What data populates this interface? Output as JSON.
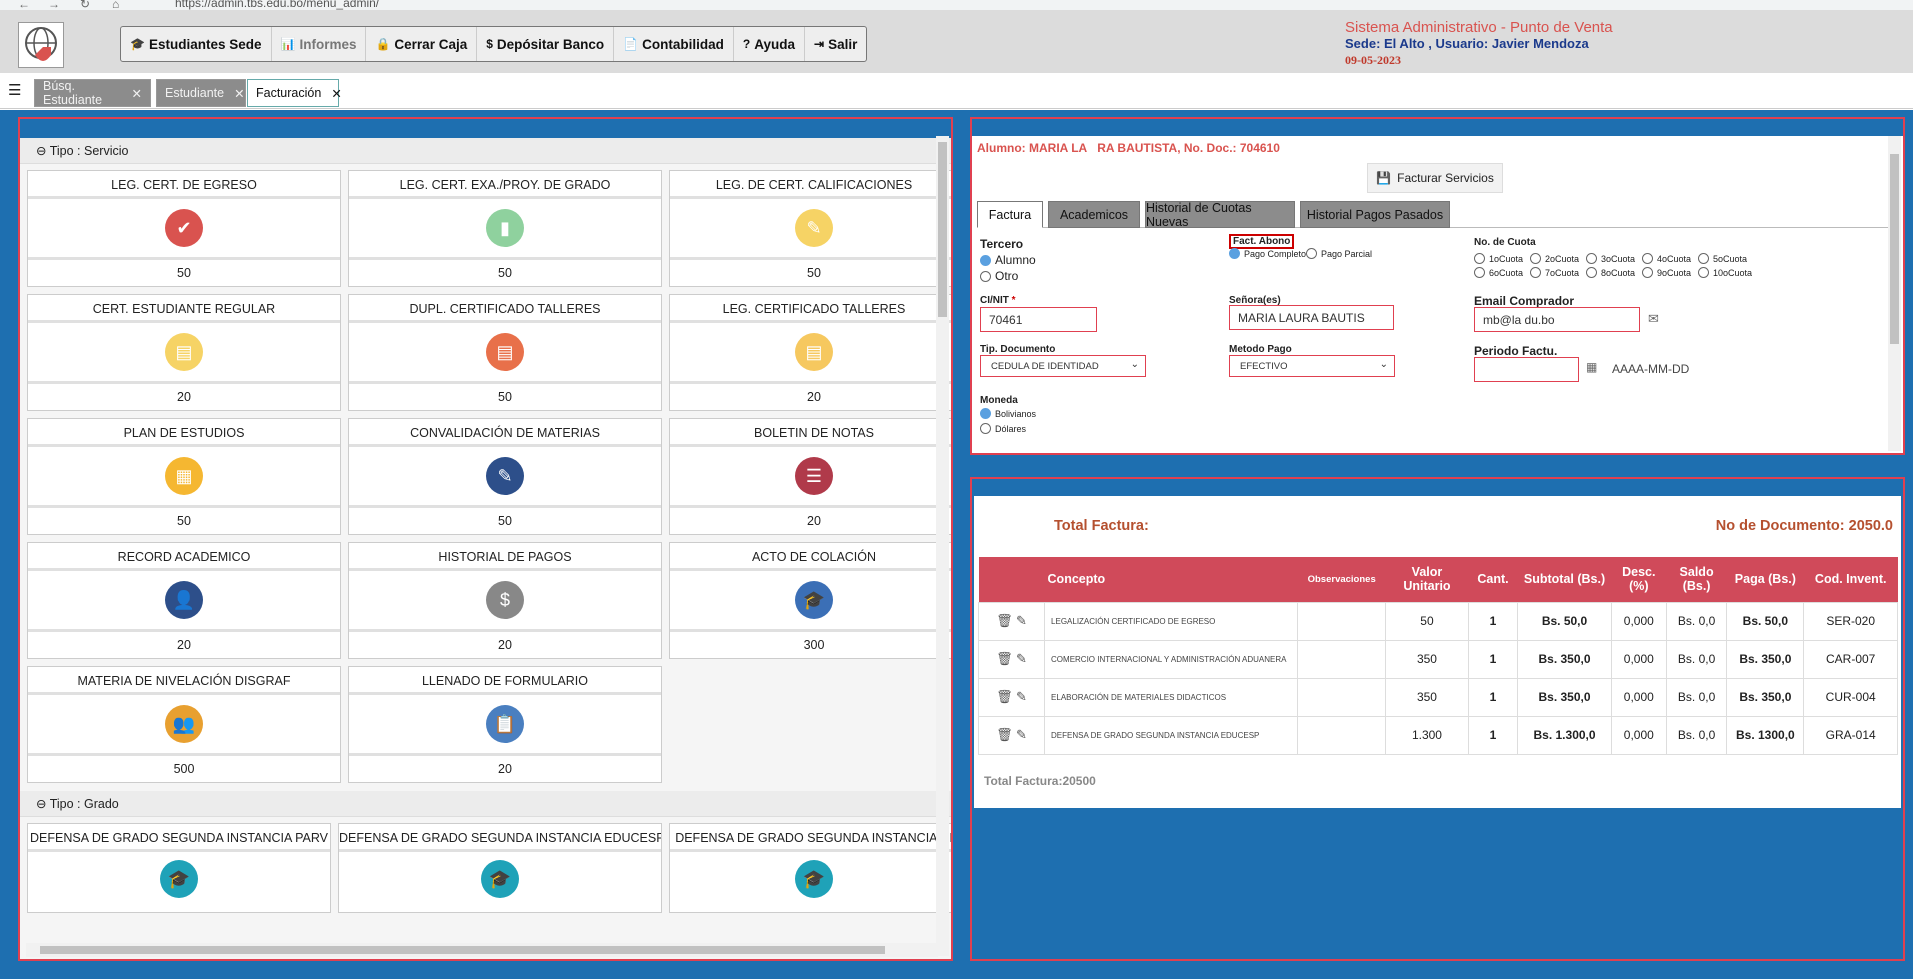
{
  "browser": {
    "url": "https://admin.tbs.edu.bo/menu_admin/"
  },
  "menu": [
    {
      "icon": "student-icon",
      "label": "Estudiantes Sede"
    },
    {
      "icon": "chart-icon",
      "label": "Informes"
    },
    {
      "icon": "lock-icon",
      "label": "Cerrar Caja"
    },
    {
      "icon": "money-icon",
      "label": "Depósitar Banco"
    },
    {
      "icon": "document-icon",
      "label": "Contabilidad"
    },
    {
      "icon": "help-icon",
      "label": "Ayuda"
    },
    {
      "icon": "logout-icon",
      "label": "Salir"
    }
  ],
  "system": {
    "title": "Sistema Administrativo - Punto de Venta",
    "sede": "Sede: El Alto , Usuario: Javier Mendoza",
    "date": "09-05-2023"
  },
  "tabs": [
    "Búsq. Estudiante",
    "Estudiante",
    "Facturación"
  ],
  "left": {
    "section_servicio": "Tipo : Servicio",
    "section_grado": "Tipo : Grado",
    "services": [
      {
        "title": "LEG. CERT. DE EGRESO",
        "price": "50",
        "icon": "books-check-icon",
        "color": "#d9534f"
      },
      {
        "title": "LEG. CERT. EXA./PROY. DE GRADO",
        "price": "50",
        "icon": "notebook-icon",
        "color": "#8fd19e"
      },
      {
        "title": "LEG. DE CERT. CALIFICACIONES",
        "price": "50",
        "icon": "clipboard-edit-icon",
        "color": "#f6d365"
      },
      {
        "title": "CERT. ESTUDIANTE REGULAR",
        "price": "20",
        "icon": "certificate-icon",
        "color": "#f6d365"
      },
      {
        "title": "DUPL. CERTIFICADO TALLERES",
        "price": "50",
        "icon": "certificate-icon",
        "color": "#e8704a"
      },
      {
        "title": "LEG. CERTIFICADO TALLERES",
        "price": "20",
        "icon": "certificate-icon",
        "color": "#f6c85f"
      },
      {
        "title": "PLAN DE ESTUDIOS",
        "price": "50",
        "icon": "grid-icon",
        "color": "#f5b731"
      },
      {
        "title": "CONVALIDACIÓN DE MATERIAS",
        "price": "50",
        "icon": "notebook-pen-icon",
        "color": "#2d4f8a"
      },
      {
        "title": "BOLETIN DE NOTAS",
        "price": "20",
        "icon": "clipboard-list-icon",
        "color": "#b03a4a"
      },
      {
        "title": "RECORD ACADEMICO",
        "price": "20",
        "icon": "graduate-icon",
        "color": "#2d4f8a"
      },
      {
        "title": "HISTORIAL DE PAGOS",
        "price": "20",
        "icon": "coins-icon",
        "color": "#888888"
      },
      {
        "title": "ACTO DE COLACIÓN",
        "price": "300",
        "icon": "graduation-cap-icon",
        "color": "#3b6fb6"
      },
      {
        "title": "MATERIA DE NIVELACIÓN DISGRAF",
        "price": "500",
        "icon": "group-icon",
        "color": "#e8a030"
      },
      {
        "title": "LLENADO DE FORMULARIO",
        "price": "20",
        "icon": "form-icon",
        "color": "#4a7fc0"
      }
    ],
    "grados": [
      {
        "title": "DEFENSA DE GRADO SEGUNDA INSTANCIA PARV"
      },
      {
        "title": "DEFENSA DE GRADO SEGUNDA INSTANCIA EDUCESP"
      },
      {
        "title": "DEFENSA DE GRADO SEGUNDA INSTANCIA DI"
      }
    ]
  },
  "factura": {
    "alumno": "Alumno: MARIA LA   RA BAUTISTA, No. Doc.: 704610",
    "facturar_btn": "Facturar Servicios",
    "tabs": [
      "Factura",
      "Academicos",
      "Historial de Cuotas Nuevas",
      "Historial Pagos Pasados"
    ],
    "tercero_label": "Tercero",
    "tercero_opts": [
      "Alumno",
      "Otro"
    ],
    "fact_abono_label": "Fact. Abono",
    "abono_opts": [
      "Pago Completo",
      "Pago Parcial"
    ],
    "cuota_label": "No. de Cuota",
    "cuotas": [
      "1oCuota",
      "2oCuota",
      "3oCuota",
      "4oCuota",
      "5oCuota",
      "6oCuota",
      "7oCuota",
      "8oCuota",
      "9oCuota",
      "10oCuota"
    ],
    "ci_label": "CI/NIT",
    "ci_value": "70461",
    "senor_label": "Señora(es)",
    "senor_value": "MARIA LAURA  BAUTIS",
    "email_label": "Email Comprador",
    "email_value": "mb@la    du.bo",
    "tipdoc_label": "Tip. Documento",
    "tipdoc_value": "CEDULA DE IDENTIDAD",
    "metodo_label": "Metodo Pago",
    "metodo_value": "EFECTIVO",
    "periodo_label": "Periodo Factu.",
    "periodo_hint": "AAAA-MM-DD",
    "moneda_label": "Moneda",
    "moneda_opts": [
      "Bolivianos",
      "Dólares"
    ]
  },
  "detalle": {
    "total_label": "Total Factura:",
    "no_doc": "No de Documento: 2050.0",
    "headers": [
      "Concepto",
      "Observaciones",
      "Valor Unitario",
      "Cant.",
      "Subtotal (Bs.)",
      "Desc. (%)",
      "Saldo (Bs.)",
      "Paga (Bs.)",
      "Cod. Invent."
    ],
    "rows": [
      {
        "concepto": "LEGALIZACIÓN CERTIFICADO DE EGRESO",
        "obs": "",
        "valor": "50",
        "cant": "1",
        "subtotal": "Bs. 50,0",
        "desc": "0,000",
        "saldo": "Bs. 0,0",
        "paga": "Bs. 50,0",
        "cod": "SER-020"
      },
      {
        "concepto": "COMERCIO INTERNACIONAL Y ADMINISTRACIÓN ADUANERA",
        "obs": "",
        "valor": "350",
        "cant": "1",
        "subtotal": "Bs. 350,0",
        "desc": "0,000",
        "saldo": "Bs. 0,0",
        "paga": "Bs. 350,0",
        "cod": "CAR-007"
      },
      {
        "concepto": "ELABORACIÓN DE MATERIALES DIDACTICOS",
        "obs": "",
        "valor": "350",
        "cant": "1",
        "subtotal": "Bs. 350,0",
        "desc": "0,000",
        "saldo": "Bs. 0,0",
        "paga": "Bs. 350,0",
        "cod": "CUR-004"
      },
      {
        "concepto": "DEFENSA DE GRADO SEGUNDA INSTANCIA EDUCESP",
        "obs": "",
        "valor": "1.300",
        "cant": "1",
        "subtotal": "Bs. 1.300,0",
        "desc": "0,000",
        "saldo": "Bs. 0,0",
        "paga": "Bs. 1300,0",
        "cod": "GRA-014"
      }
    ],
    "total_line": "Total Factura:20500"
  }
}
